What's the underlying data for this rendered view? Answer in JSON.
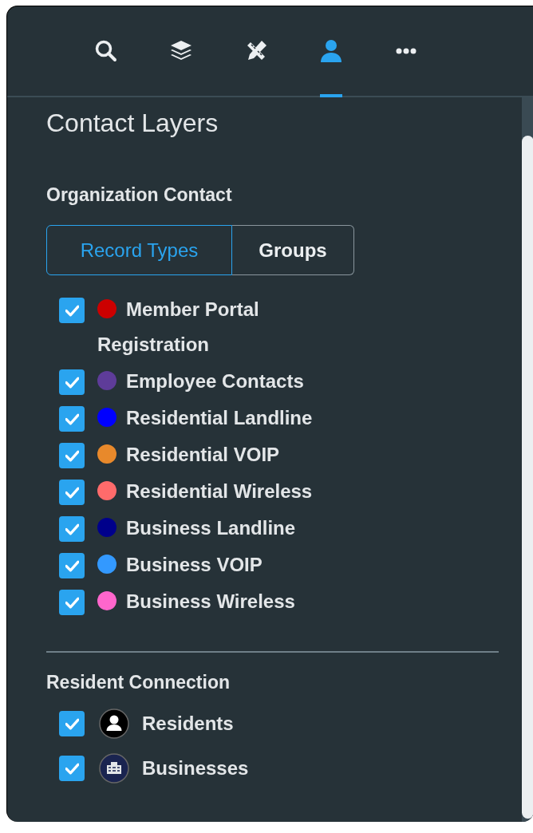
{
  "toolbar": {
    "tabs": [
      {
        "kind": "search",
        "selected": false
      },
      {
        "kind": "layers",
        "selected": false
      },
      {
        "kind": "tools",
        "selected": false
      },
      {
        "kind": "person",
        "selected": true
      },
      {
        "kind": "more",
        "selected": false
      }
    ]
  },
  "title": "Contact Layers",
  "organization_contact": {
    "heading": "Organization Contact",
    "segments": [
      {
        "label": "Record Types",
        "selected": true
      },
      {
        "label": "Groups",
        "selected": false
      }
    ],
    "items": [
      {
        "label": "Member Portal Registration",
        "checked": true,
        "color": "#cc0000"
      },
      {
        "label": "Employee Contacts",
        "checked": true,
        "color": "#5e3c99"
      },
      {
        "label": "Residential Landline",
        "checked": true,
        "color": "#0000ff"
      },
      {
        "label": "Residential VOIP",
        "checked": true,
        "color": "#e8892b"
      },
      {
        "label": "Residential Wireless",
        "checked": true,
        "color": "#ff6b6b"
      },
      {
        "label": "Business Landline",
        "checked": true,
        "color": "#00008b"
      },
      {
        "label": "Business VOIP",
        "checked": true,
        "color": "#3399ff"
      },
      {
        "label": "Business Wireless",
        "checked": true,
        "color": "#ff66cc"
      }
    ]
  },
  "resident_connection": {
    "heading": "Resident Connection",
    "items": [
      {
        "label": "Residents",
        "checked": true,
        "kind": "person"
      },
      {
        "label": "Businesses",
        "checked": true,
        "kind": "building"
      }
    ]
  }
}
